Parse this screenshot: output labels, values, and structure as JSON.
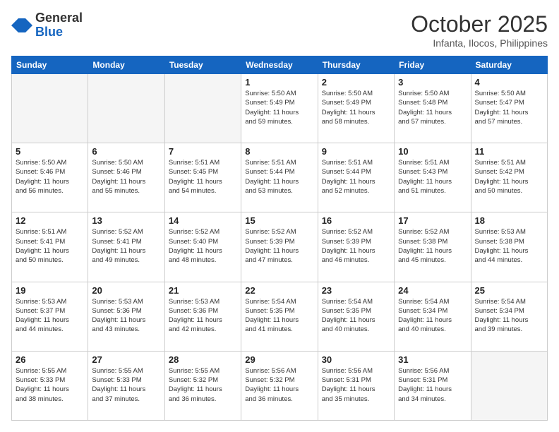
{
  "header": {
    "logo": {
      "general": "General",
      "blue": "Blue"
    },
    "title": "October 2025",
    "subtitle": "Infanta, Ilocos, Philippines"
  },
  "weekdays": [
    "Sunday",
    "Monday",
    "Tuesday",
    "Wednesday",
    "Thursday",
    "Friday",
    "Saturday"
  ],
  "weeks": [
    [
      {
        "day": "",
        "info": ""
      },
      {
        "day": "",
        "info": ""
      },
      {
        "day": "",
        "info": ""
      },
      {
        "day": "1",
        "info": "Sunrise: 5:50 AM\nSunset: 5:49 PM\nDaylight: 11 hours\nand 59 minutes."
      },
      {
        "day": "2",
        "info": "Sunrise: 5:50 AM\nSunset: 5:49 PM\nDaylight: 11 hours\nand 58 minutes."
      },
      {
        "day": "3",
        "info": "Sunrise: 5:50 AM\nSunset: 5:48 PM\nDaylight: 11 hours\nand 57 minutes."
      },
      {
        "day": "4",
        "info": "Sunrise: 5:50 AM\nSunset: 5:47 PM\nDaylight: 11 hours\nand 57 minutes."
      }
    ],
    [
      {
        "day": "5",
        "info": "Sunrise: 5:50 AM\nSunset: 5:46 PM\nDaylight: 11 hours\nand 56 minutes."
      },
      {
        "day": "6",
        "info": "Sunrise: 5:50 AM\nSunset: 5:46 PM\nDaylight: 11 hours\nand 55 minutes."
      },
      {
        "day": "7",
        "info": "Sunrise: 5:51 AM\nSunset: 5:45 PM\nDaylight: 11 hours\nand 54 minutes."
      },
      {
        "day": "8",
        "info": "Sunrise: 5:51 AM\nSunset: 5:44 PM\nDaylight: 11 hours\nand 53 minutes."
      },
      {
        "day": "9",
        "info": "Sunrise: 5:51 AM\nSunset: 5:44 PM\nDaylight: 11 hours\nand 52 minutes."
      },
      {
        "day": "10",
        "info": "Sunrise: 5:51 AM\nSunset: 5:43 PM\nDaylight: 11 hours\nand 51 minutes."
      },
      {
        "day": "11",
        "info": "Sunrise: 5:51 AM\nSunset: 5:42 PM\nDaylight: 11 hours\nand 50 minutes."
      }
    ],
    [
      {
        "day": "12",
        "info": "Sunrise: 5:51 AM\nSunset: 5:41 PM\nDaylight: 11 hours\nand 50 minutes."
      },
      {
        "day": "13",
        "info": "Sunrise: 5:52 AM\nSunset: 5:41 PM\nDaylight: 11 hours\nand 49 minutes."
      },
      {
        "day": "14",
        "info": "Sunrise: 5:52 AM\nSunset: 5:40 PM\nDaylight: 11 hours\nand 48 minutes."
      },
      {
        "day": "15",
        "info": "Sunrise: 5:52 AM\nSunset: 5:39 PM\nDaylight: 11 hours\nand 47 minutes."
      },
      {
        "day": "16",
        "info": "Sunrise: 5:52 AM\nSunset: 5:39 PM\nDaylight: 11 hours\nand 46 minutes."
      },
      {
        "day": "17",
        "info": "Sunrise: 5:52 AM\nSunset: 5:38 PM\nDaylight: 11 hours\nand 45 minutes."
      },
      {
        "day": "18",
        "info": "Sunrise: 5:53 AM\nSunset: 5:38 PM\nDaylight: 11 hours\nand 44 minutes."
      }
    ],
    [
      {
        "day": "19",
        "info": "Sunrise: 5:53 AM\nSunset: 5:37 PM\nDaylight: 11 hours\nand 44 minutes."
      },
      {
        "day": "20",
        "info": "Sunrise: 5:53 AM\nSunset: 5:36 PM\nDaylight: 11 hours\nand 43 minutes."
      },
      {
        "day": "21",
        "info": "Sunrise: 5:53 AM\nSunset: 5:36 PM\nDaylight: 11 hours\nand 42 minutes."
      },
      {
        "day": "22",
        "info": "Sunrise: 5:54 AM\nSunset: 5:35 PM\nDaylight: 11 hours\nand 41 minutes."
      },
      {
        "day": "23",
        "info": "Sunrise: 5:54 AM\nSunset: 5:35 PM\nDaylight: 11 hours\nand 40 minutes."
      },
      {
        "day": "24",
        "info": "Sunrise: 5:54 AM\nSunset: 5:34 PM\nDaylight: 11 hours\nand 40 minutes."
      },
      {
        "day": "25",
        "info": "Sunrise: 5:54 AM\nSunset: 5:34 PM\nDaylight: 11 hours\nand 39 minutes."
      }
    ],
    [
      {
        "day": "26",
        "info": "Sunrise: 5:55 AM\nSunset: 5:33 PM\nDaylight: 11 hours\nand 38 minutes."
      },
      {
        "day": "27",
        "info": "Sunrise: 5:55 AM\nSunset: 5:33 PM\nDaylight: 11 hours\nand 37 minutes."
      },
      {
        "day": "28",
        "info": "Sunrise: 5:55 AM\nSunset: 5:32 PM\nDaylight: 11 hours\nand 36 minutes."
      },
      {
        "day": "29",
        "info": "Sunrise: 5:56 AM\nSunset: 5:32 PM\nDaylight: 11 hours\nand 36 minutes."
      },
      {
        "day": "30",
        "info": "Sunrise: 5:56 AM\nSunset: 5:31 PM\nDaylight: 11 hours\nand 35 minutes."
      },
      {
        "day": "31",
        "info": "Sunrise: 5:56 AM\nSunset: 5:31 PM\nDaylight: 11 hours\nand 34 minutes."
      },
      {
        "day": "",
        "info": ""
      }
    ]
  ]
}
